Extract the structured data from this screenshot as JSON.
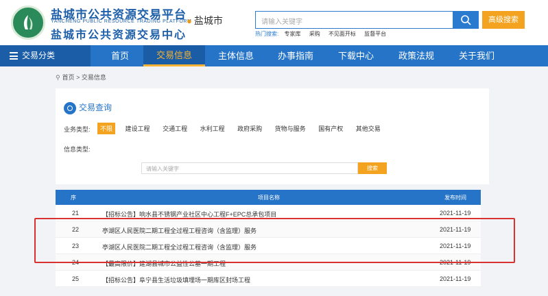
{
  "header": {
    "brand_cn": "盐城市公共资源交易平台",
    "brand_en": "YANCHENG PUBLIC RESOURCE TRADING PLATFORM",
    "brand_cn2": "盐城市公共资源交易中心",
    "city": "盐城市",
    "search_placeholder": "请输入关键字",
    "advanced_search": "高级搜索",
    "hot_label": "热门搜索:",
    "hot_keywords": [
      "专家库",
      "采购",
      "不见面开标",
      "监督平台"
    ]
  },
  "nav": {
    "category": "交易分类",
    "items": [
      {
        "label": "首页"
      },
      {
        "label": "交易信息",
        "active": true
      },
      {
        "label": "主体信息"
      },
      {
        "label": "办事指南"
      },
      {
        "label": "下载中心"
      },
      {
        "label": "政策法规"
      },
      {
        "label": "关于我们"
      }
    ]
  },
  "breadcrumb": "首页 > 交易信息",
  "query": {
    "title": "交易查询",
    "business_type_label": "业务类型:",
    "business_types": [
      "不限",
      "建设工程",
      "交通工程",
      "水利工程",
      "政府采购",
      "货物与服务",
      "国有产权",
      "其他交易"
    ],
    "info_type_label": "信息类型:",
    "keyword_placeholder": "请输入关键字",
    "search_button": "搜索"
  },
  "table": {
    "columns": [
      "序",
      "项目名称",
      "发布时间"
    ],
    "rows": [
      {
        "no": "21",
        "name": "【招标公告】响水县不锈钢产业社区中心工程F+EPC总承包项目",
        "date": "2021-11-19"
      },
      {
        "no": "22",
        "name": "亭湖区人民医院二期工程全过程工程咨询（含监理）服务",
        "date": "2021-11-19"
      },
      {
        "no": "23",
        "name": "亭湖区人民医院二期工程全过程工程咨询（含监理）服务",
        "date": "2021-11-19"
      },
      {
        "no": "24",
        "name": "【最高限价】建湖县城市公益性公墓一期工程",
        "date": "2021-11-19"
      },
      {
        "no": "25",
        "name": "【招标公告】阜宁县生活垃圾填埋场一期库区封场工程",
        "date": "2021-11-19"
      }
    ]
  },
  "colors": {
    "primary": "#2574c7",
    "accent": "#f3a320",
    "highlight": "#d8312f"
  }
}
